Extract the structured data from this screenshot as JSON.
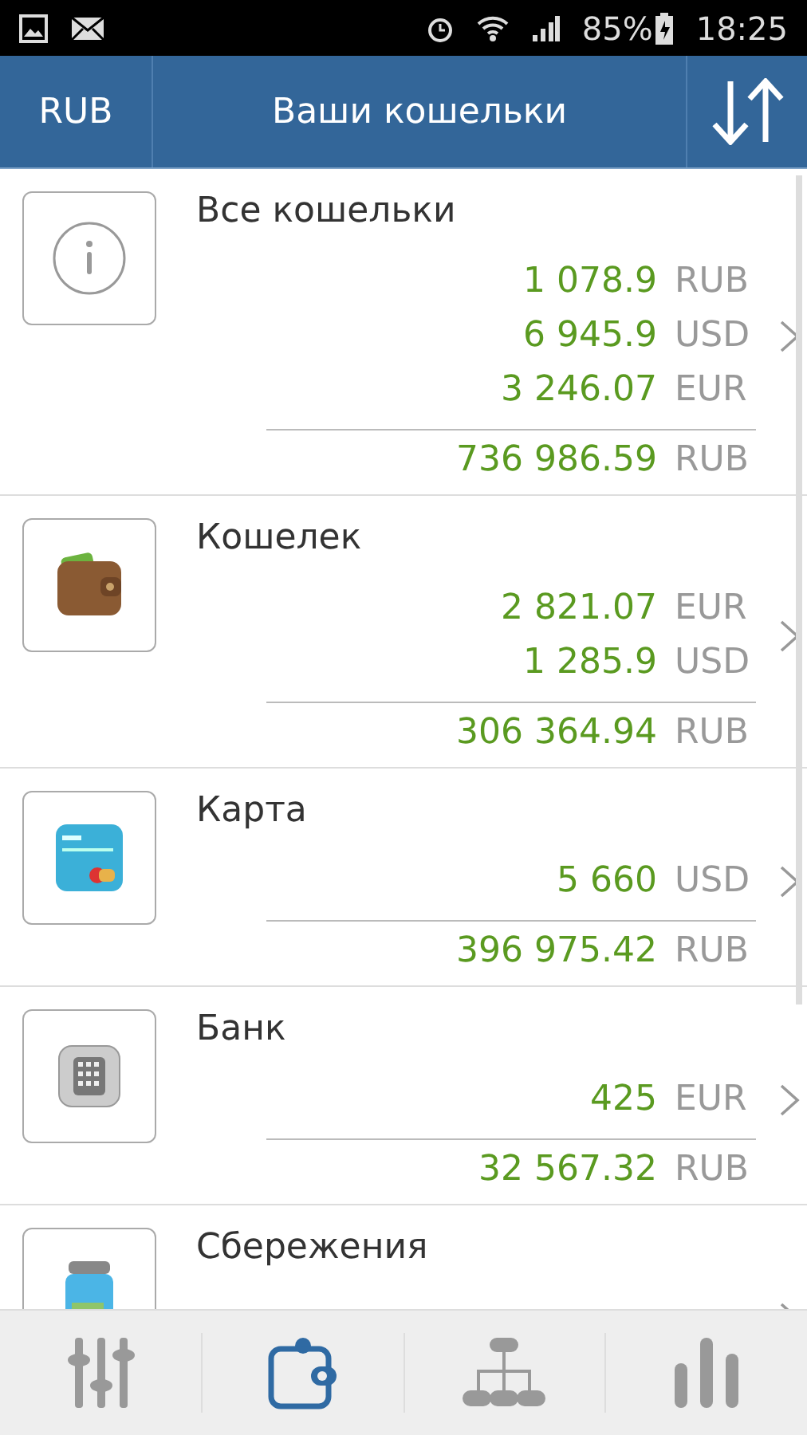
{
  "status_bar": {
    "battery": "85%",
    "time": "18:25"
  },
  "header": {
    "currency": "RUB",
    "title": "Ваши кошельки"
  },
  "wallets": [
    {
      "name": "Все кошельки",
      "kind": "info",
      "amounts": [
        {
          "value": "1 078.9",
          "currency": "RUB"
        },
        {
          "value": "6 945.9",
          "currency": "USD"
        },
        {
          "value": "3 246.07",
          "currency": "EUR"
        }
      ],
      "total": {
        "value": "736 986.59",
        "currency": "RUB"
      }
    },
    {
      "name": "Кошелек",
      "kind": "wallet",
      "amounts": [
        {
          "value": "2 821.07",
          "currency": "EUR"
        },
        {
          "value": "1 285.9",
          "currency": "USD"
        }
      ],
      "total": {
        "value": "306 364.94",
        "currency": "RUB"
      }
    },
    {
      "name": "Карта",
      "kind": "card",
      "amounts": [
        {
          "value": "5 660",
          "currency": "USD"
        }
      ],
      "total": {
        "value": "396 975.42",
        "currency": "RUB"
      }
    },
    {
      "name": "Банк",
      "kind": "safe",
      "amounts": [
        {
          "value": "425",
          "currency": "EUR"
        }
      ],
      "total": {
        "value": "32 567.32",
        "currency": "RUB"
      }
    },
    {
      "name": "Сбережения",
      "kind": "jar"
    }
  ],
  "tabs": [
    {
      "kind": "sliders",
      "selected": false
    },
    {
      "kind": "wallet",
      "selected": true
    },
    {
      "kind": "tree",
      "selected": false
    },
    {
      "kind": "bars",
      "selected": false
    }
  ]
}
